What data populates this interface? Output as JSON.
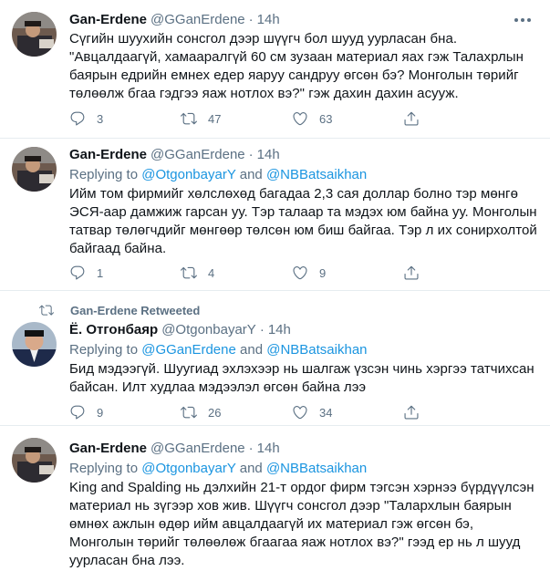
{
  "tweets": [
    {
      "name": "Gan-Erdene",
      "handle": "@GGanErdene",
      "dot": "·",
      "time": "14h",
      "lines": [
        "Сүгийн шуухийн сонсгол дээр шүүгч бол шууд уурласан бна.",
        "\"Авцалдаагүй, хамааралгүй 60 см зузаан материал яах гэж Талахрлын",
        "баярын едрийн емнех едер яаруу сандруу өгсөн бэ? Монголын төрийг",
        "төлөөлж бгаа гэдгээ яаж нотлох вэ?\" гэж дахин дахин асууж."
      ],
      "actions": {
        "reply": "3",
        "retweet": "47",
        "like": "63"
      }
    },
    {
      "name": "Gan-Erdene",
      "handle": "@GGanErdene",
      "dot": "·",
      "time": "14h",
      "replying_prefix": "Replying to ",
      "replying_user1": "@OtgonbayarY",
      "replying_and": " and ",
      "replying_user2": "@NBBatsaikhan",
      "lines": [
        "Ийм том фирмийг хөлслөхөд багадаа 2,3 сая доллар болно тэр мөнгө",
        "ЭСЯ-аар дамжиж гарсан уу. Тэр талаар та мэдэх юм байна уу. Монголын",
        "татвар төлөгчдийг мөнгөөр төлсөн юм биш байгаа. Тэр л их сонирхолтой",
        "байгаад байна."
      ],
      "actions": {
        "reply": "1",
        "retweet": "4",
        "like": "9"
      }
    },
    {
      "retweeted_by": "Gan-Erdene Retweeted",
      "name": "Ё. Отгонбаяр",
      "handle": "@OtgonbayarY",
      "dot": "·",
      "time": "14h",
      "replying_prefix": "Replying to ",
      "replying_user1": "@GGanErdene",
      "replying_and": " and ",
      "replying_user2": "@NBBatsaikhan",
      "lines": [
        "Бид мэдээгүй. Шуугиад эхлэхээр нь шалгаж үзсэн чинь хэргээ татчихсан",
        "байсан. Илт худлаа мэдээлэл өгсөн байна лээ"
      ],
      "actions": {
        "reply": "9",
        "retweet": "26",
        "like": "34"
      }
    },
    {
      "name": "Gan-Erdene",
      "handle": "@GGanErdene",
      "dot": "·",
      "time": "14h",
      "replying_prefix": "Replying to ",
      "replying_user1": "@OtgonbayarY",
      "replying_and": " and ",
      "replying_user2": "@NBBatsaikhan",
      "lines": [
        "King and Spalding нь дэлхийн 21-т ордог фирм тэгсэн хэрнээ бүрдүүлсэн",
        "материал нь зүгээр хов жив. Шүүгч сонсгол дээр \"Талархлын баярын",
        "өмнөх ажлын өдөр ийм авцалдаагүй их материал гэж өгсөн бэ,",
        "Монголын төрийг төлөөлөж бгаагаа яаж нотлох вэ?\" гээд ер нь л шууд",
        "уурласан бна лээ."
      ]
    }
  ],
  "icons": {
    "reply": "comment-icon",
    "retweet": "retweet-icon",
    "like": "heart-icon",
    "share": "share-icon",
    "more": "more-icon"
  },
  "colors": {
    "text": "#0f1419",
    "secondary": "#5b7083",
    "link": "#1b95e0",
    "divider": "#e6ecf0"
  }
}
